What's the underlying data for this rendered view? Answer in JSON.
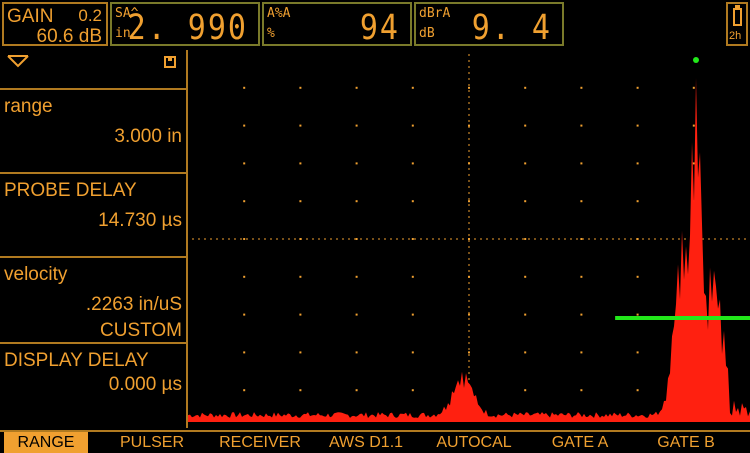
{
  "status_bar": {
    "gain": {
      "label": "GAIN",
      "step": "0.2",
      "value": "60.6 dB"
    },
    "readings": [
      {
        "line1": "SA^",
        "line2": "in",
        "value": "2. 990"
      },
      {
        "line1": "A%A",
        "line2": "%",
        "value": "94"
      },
      {
        "line1": "dBrA",
        "line2": "dB",
        "value": "9. 4"
      }
    ],
    "battery": {
      "label": "2h"
    }
  },
  "panel": {
    "header_icons": [
      "chevron-down-icon",
      "save-icon"
    ],
    "params": [
      {
        "name": "range",
        "value": "3.000 in"
      },
      {
        "name": "PROBE DELAY",
        "value": "14.730 µs"
      },
      {
        "name": "velocity",
        "value": ".2263 in/uS",
        "value2": "CUSTOM"
      },
      {
        "name": "DISPLAY DELAY",
        "value": "0.000 µs"
      }
    ]
  },
  "ascan": {
    "trace_color": "#ff2010",
    "gate_color": "#22e81a",
    "gate_level_percent": 27,
    "gate_start_fraction": 0.76,
    "grid": "dotted",
    "peak_amplitude_percent": 94
  },
  "tabs": {
    "items": [
      "RANGE",
      "PULSER",
      "RECEIVER",
      "AWS D1.1",
      "AUTOCAL",
      "GATE A",
      "GATE B"
    ],
    "active": "RANGE"
  },
  "colors": {
    "accent": "#f0a030",
    "border": "#b07a20",
    "background": "#000000"
  }
}
